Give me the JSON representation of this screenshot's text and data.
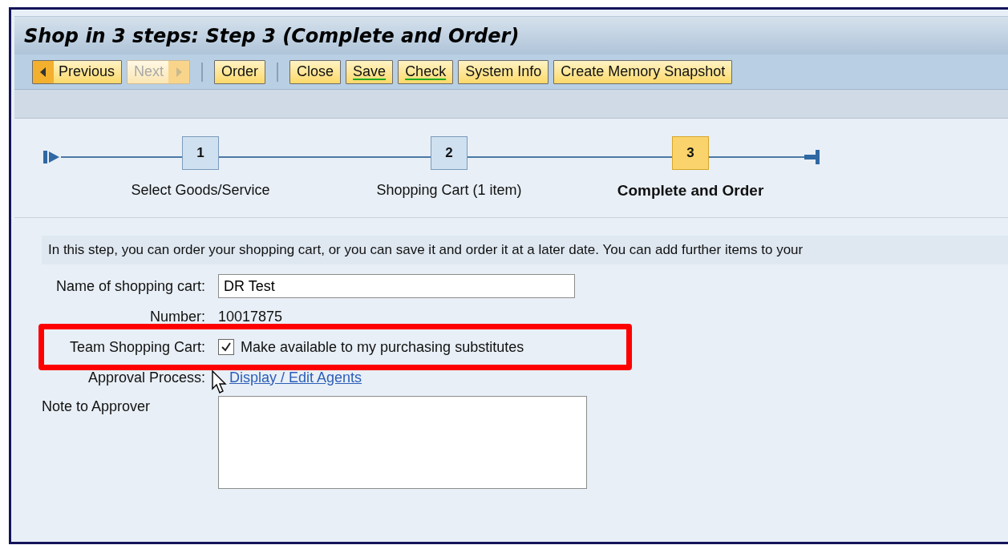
{
  "window": {
    "title": "Shop in 3 steps: Step 3 (Complete and Order)"
  },
  "toolbar": [
    {
      "kind": "prev",
      "label": "Previous",
      "disabled": false,
      "hotkey": false
    },
    {
      "kind": "next",
      "label": "Next",
      "disabled": true,
      "hotkey": false
    },
    {
      "kind": "separator"
    },
    {
      "kind": "button",
      "label": "Order",
      "disabled": false,
      "hotkey": false
    },
    {
      "kind": "separator"
    },
    {
      "kind": "button",
      "label": "Close",
      "disabled": false,
      "hotkey": false
    },
    {
      "kind": "button",
      "label": "Save",
      "disabled": false,
      "hotkey": true
    },
    {
      "kind": "button",
      "label": "Check",
      "disabled": false,
      "hotkey": true
    },
    {
      "kind": "button",
      "label": "System Info",
      "disabled": false,
      "hotkey": false
    },
    {
      "kind": "button",
      "label": "Create Memory Snapshot",
      "disabled": false,
      "hotkey": false
    }
  ],
  "steps": [
    {
      "number": "1",
      "label": "Select Goods/Service",
      "selected": false
    },
    {
      "number": "2",
      "label": "Shopping Cart (1 item)",
      "selected": false
    },
    {
      "number": "3",
      "label": "Complete and Order",
      "selected": true
    }
  ],
  "info": "In this step, you can order your shopping cart, or you can save it and order it at a later date. You can add further items to your",
  "form": [
    {
      "kind": "input",
      "label": "Name of shopping cart:",
      "value": "DR Test"
    },
    {
      "kind": "text",
      "label": "Number:",
      "value": "10017875"
    },
    {
      "kind": "checkbox",
      "label": "Team Shopping Cart:",
      "value": "Make available to my purchasing substitutes",
      "checked": true,
      "highlighted": true
    },
    {
      "kind": "link",
      "label": "Approval Process:",
      "value": "Display / Edit Agents"
    },
    {
      "kind": "textarea",
      "label": "Note to Approver"
    }
  ]
}
